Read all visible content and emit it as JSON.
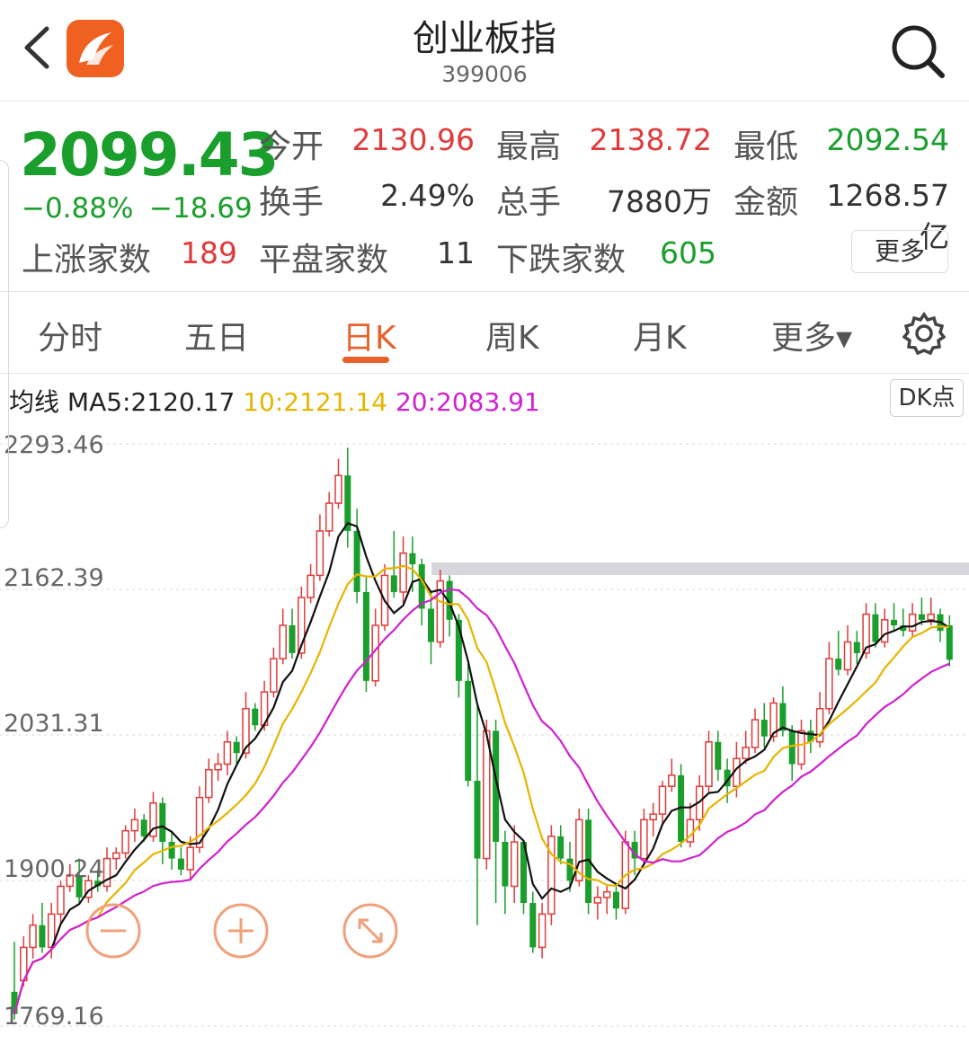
{
  "header": {
    "title": "创业板指",
    "code": "399006"
  },
  "quote": {
    "price": "2099.43",
    "change_pct": "−0.88%",
    "change_abs": "−18.69",
    "fields": [
      {
        "label": "今开",
        "value": "2130.96",
        "color": "red"
      },
      {
        "label": "最高",
        "value": "2138.72",
        "color": "red"
      },
      {
        "label": "最低",
        "value": "2092.54",
        "color": "green"
      },
      {
        "label": "换手",
        "value": "2.49%",
        "color": "dark"
      },
      {
        "label": "总手",
        "value": "7880万",
        "color": "dark"
      },
      {
        "label": "金额",
        "value": "1268.57亿",
        "color": "dark"
      }
    ],
    "breadth": [
      {
        "label": "上涨家数",
        "value": "189",
        "color": "red"
      },
      {
        "label": "平盘家数",
        "value": "11",
        "color": "dark"
      },
      {
        "label": "下跌家数",
        "value": "605",
        "color": "green"
      }
    ],
    "more_label": "更多"
  },
  "tabs": [
    {
      "label": "分时"
    },
    {
      "label": "五日"
    },
    {
      "label": "日K",
      "active": true
    },
    {
      "label": "周K"
    },
    {
      "label": "月K"
    },
    {
      "label": "更多▾"
    }
  ],
  "ma": {
    "label": "均线",
    "ma5": "MA5:2120.17",
    "ma10": "10:2121.14",
    "ma20": "20:2083.91",
    "dk_label": "DK点"
  },
  "colors": {
    "up": "#e03a3a",
    "down": "#1a9e2c",
    "accent": "#e8612c",
    "ma5": "#111111",
    "ma10": "#e8b400",
    "ma20": "#d020d0"
  },
  "icons": [
    "back-chevron-icon",
    "app-logo-icon",
    "search-icon",
    "settings-gear-icon",
    "zoom-out-icon",
    "zoom-in-icon",
    "fullscreen-icon"
  ],
  "chart_data": {
    "type": "candlestick",
    "ylim": [
      1769.16,
      2293.46
    ],
    "y_ticks": [
      "2293.46",
      "2162.39",
      "2031.31",
      "1900.24",
      "1769.16"
    ],
    "candles": [
      [
        1800,
        1780,
        1845,
        1775
      ],
      [
        1810,
        1840,
        1850,
        1805
      ],
      [
        1840,
        1860,
        1870,
        1830
      ],
      [
        1860,
        1840,
        1880,
        1835
      ],
      [
        1840,
        1870,
        1880,
        1830
      ],
      [
        1870,
        1895,
        1900,
        1860
      ],
      [
        1895,
        1905,
        1915,
        1890
      ],
      [
        1905,
        1885,
        1920,
        1880
      ],
      [
        1885,
        1900,
        1905,
        1880
      ],
      [
        1900,
        1895,
        1910,
        1890
      ],
      [
        1895,
        1920,
        1930,
        1890
      ],
      [
        1920,
        1925,
        1930,
        1910
      ],
      [
        1925,
        1945,
        1950,
        1920
      ],
      [
        1945,
        1955,
        1965,
        1935
      ],
      [
        1955,
        1940,
        1960,
        1935
      ],
      [
        1940,
        1970,
        1980,
        1935
      ],
      [
        1970,
        1935,
        1975,
        1915
      ],
      [
        1935,
        1920,
        1945,
        1910
      ],
      [
        1920,
        1910,
        1930,
        1905
      ],
      [
        1910,
        1930,
        1940,
        1900
      ],
      [
        1930,
        1975,
        1985,
        1925
      ],
      [
        1975,
        2000,
        2010,
        1970
      ],
      [
        2000,
        2005,
        2015,
        1990
      ],
      [
        2005,
        2025,
        2035,
        1995
      ],
      [
        2025,
        2015,
        2030,
        2005
      ],
      [
        2015,
        2055,
        2070,
        2010
      ],
      [
        2055,
        2040,
        2060,
        2035
      ],
      [
        2040,
        2070,
        2080,
        2035
      ],
      [
        2070,
        2100,
        2110,
        2065
      ],
      [
        2100,
        2130,
        2145,
        2095
      ],
      [
        2130,
        2105,
        2145,
        2100
      ],
      [
        2105,
        2155,
        2165,
        2100
      ],
      [
        2155,
        2175,
        2185,
        2150
      ],
      [
        2175,
        2215,
        2230,
        2170
      ],
      [
        2215,
        2240,
        2250,
        2210
      ],
      [
        2240,
        2265,
        2280,
        2235
      ],
      [
        2265,
        2215,
        2290,
        2200
      ],
      [
        2215,
        2160,
        2235,
        2150
      ],
      [
        2160,
        2080,
        2175,
        2070
      ],
      [
        2080,
        2130,
        2145,
        2075
      ],
      [
        2130,
        2175,
        2185,
        2125
      ],
      [
        2175,
        2160,
        2215,
        2155
      ],
      [
        2160,
        2195,
        2210,
        2150
      ],
      [
        2195,
        2185,
        2210,
        2160
      ],
      [
        2185,
        2145,
        2190,
        2130
      ],
      [
        2145,
        2115,
        2160,
        2095
      ],
      [
        2115,
        2170,
        2180,
        2110
      ],
      [
        2170,
        2135,
        2175,
        2120
      ],
      [
        2135,
        2080,
        2140,
        2065
      ],
      [
        2080,
        1990,
        2095,
        1985
      ],
      [
        1990,
        1920,
        2060,
        1860
      ],
      [
        1920,
        2035,
        2045,
        1910
      ],
      [
        2035,
        1935,
        2045,
        1880
      ],
      [
        1935,
        1895,
        1945,
        1870
      ],
      [
        1895,
        1935,
        1950,
        1880
      ],
      [
        1935,
        1880,
        1935,
        1870
      ],
      [
        1880,
        1840,
        1890,
        1835
      ],
      [
        1840,
        1870,
        1880,
        1830
      ],
      [
        1870,
        1940,
        1950,
        1860
      ],
      [
        1940,
        1920,
        1950,
        1915
      ],
      [
        1920,
        1900,
        1935,
        1890
      ],
      [
        1900,
        1955,
        1965,
        1895
      ],
      [
        1955,
        1880,
        1965,
        1870
      ],
      [
        1880,
        1885,
        1895,
        1865
      ],
      [
        1885,
        1890,
        1895,
        1870
      ],
      [
        1890,
        1875,
        1895,
        1865
      ],
      [
        1875,
        1935,
        1945,
        1870
      ],
      [
        1935,
        1920,
        1945,
        1905
      ],
      [
        1920,
        1955,
        1965,
        1915
      ],
      [
        1955,
        1960,
        1970,
        1940
      ],
      [
        1960,
        1985,
        1990,
        1950
      ],
      [
        1985,
        1995,
        2010,
        1980
      ],
      [
        1995,
        1935,
        2005,
        1930
      ],
      [
        1935,
        1955,
        1970,
        1930
      ],
      [
        1955,
        1985,
        1995,
        1945
      ],
      [
        1985,
        2025,
        2035,
        1980
      ],
      [
        2025,
        2000,
        2035,
        1990
      ],
      [
        2000,
        1985,
        2010,
        1970
      ],
      [
        1985,
        2010,
        2025,
        1975
      ],
      [
        2010,
        2020,
        2035,
        2005
      ],
      [
        2020,
        2045,
        2055,
        2015
      ],
      [
        2045,
        2030,
        2060,
        2020
      ],
      [
        2030,
        2060,
        2065,
        2025
      ],
      [
        2060,
        2035,
        2075,
        2030
      ],
      [
        2035,
        2005,
        2040,
        1990
      ],
      [
        2005,
        2035,
        2045,
        2000
      ],
      [
        2035,
        2025,
        2045,
        2015
      ],
      [
        2025,
        2055,
        2070,
        2020
      ],
      [
        2055,
        2100,
        2115,
        2050
      ],
      [
        2100,
        2090,
        2125,
        2085
      ],
      [
        2090,
        2115,
        2130,
        2085
      ],
      [
        2115,
        2105,
        2125,
        2095
      ],
      [
        2105,
        2140,
        2150,
        2100
      ],
      [
        2140,
        2115,
        2150,
        2110
      ],
      [
        2115,
        2135,
        2145,
        2110
      ],
      [
        2135,
        2130,
        2150,
        2125
      ],
      [
        2130,
        2125,
        2145,
        2120
      ],
      [
        2125,
        2140,
        2150,
        2120
      ],
      [
        2140,
        2135,
        2155,
        2130
      ],
      [
        2135,
        2140,
        2155,
        2130
      ],
      [
        2140,
        2125,
        2145,
        2115
      ],
      [
        2130,
        2099,
        2139,
        2093
      ]
    ]
  }
}
